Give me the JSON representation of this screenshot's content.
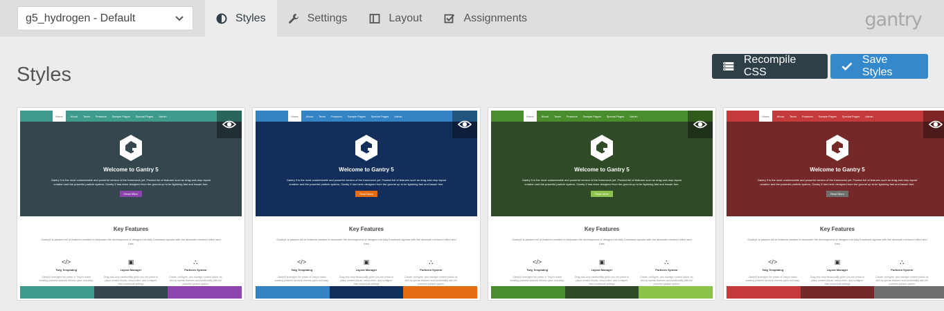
{
  "theme_select": {
    "value": "g5_hydrogen - Default"
  },
  "tabs": [
    {
      "label": "Styles",
      "icon": "contrast-icon",
      "active": true
    },
    {
      "label": "Settings",
      "icon": "wrench-icon"
    },
    {
      "label": "Layout",
      "icon": "layout-icon"
    },
    {
      "label": "Assignments",
      "icon": "check-square-icon"
    }
  ],
  "logo": "gantry",
  "page_title": "Styles",
  "buttons": {
    "recompile": "Recompile CSS",
    "save": "Save Styles"
  },
  "preview": {
    "nav": [
      "Home",
      "About",
      "Team",
      "Features",
      "Sample Pages",
      "Special Pages",
      "Admin"
    ],
    "hero_title": "Welcome to Gantry 5",
    "hero_text": "Gantry 5 is the most customizable and powerful version of the framework yet. Packed full of features such as drag-and-drop layout creation and the powerful particle system, Gantry 5 has been designed from the ground up to be lightning fast and hassle free.",
    "read_more": "Read More",
    "kf_title": "Key Features",
    "kf_text": "Gantry5 is packed full of features created to empower the development of designs into fully functional layouts with the absolute minimum effort and fuss",
    "features": [
      {
        "icon": "</>",
        "name": "Twig Templating",
        "desc": "Gantry5 leverages the power of Twig to make creating powerful dynamic themes quick and easy."
      },
      {
        "icon": "▣",
        "name": "Layout Manager",
        "desc": "Drag-and-drop functionality gives you the power to place content blocks, resize them, and configure their contextual settings"
      },
      {
        "icon": "⛬",
        "name": "Particles System",
        "desc": "Create, configure, and manage content blocks as well as special features and functionality with the powerful particle system"
      }
    ]
  },
  "presets": [
    {
      "nav": "#3f9c8d",
      "hero": "#34474f",
      "button": "#8e44ad",
      "swatches": [
        "#3f9c8d",
        "#34474f",
        "#8e44ad"
      ]
    },
    {
      "nav": "#3383c5",
      "hero": "#132e5a",
      "button": "#e46c13",
      "swatches": [
        "#3383c5",
        "#132e5a",
        "#e46c13"
      ]
    },
    {
      "nav": "#4a8d2d",
      "hero": "#2f4a27",
      "button": "#8cc34b",
      "swatches": [
        "#4a8d2d",
        "#2f4a27",
        "#8cc34b"
      ]
    },
    {
      "nav": "#c53a3a",
      "hero": "#742828",
      "button": "#6f6f6f",
      "swatches": [
        "#c53a3a",
        "#742828",
        "#6f6f6f"
      ]
    }
  ]
}
